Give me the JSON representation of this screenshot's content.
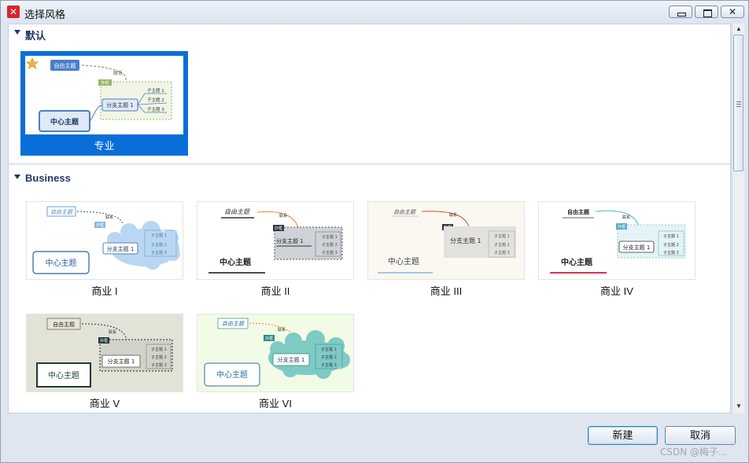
{
  "window": {
    "title": "选择风格",
    "app_icon": "xmind-icon"
  },
  "sections": [
    {
      "header": "默认",
      "items": [
        {
          "label": "专业",
          "selected": true,
          "theme": "professional"
        }
      ]
    },
    {
      "header": "Business",
      "items": [
        {
          "label": "商业 I",
          "theme": "business1"
        },
        {
          "label": "商业 II",
          "theme": "business2"
        },
        {
          "label": "商业 III",
          "theme": "business3"
        },
        {
          "label": "商业 IV",
          "theme": "business4"
        },
        {
          "label": "商业 V",
          "theme": "business5"
        },
        {
          "label": "商业 VI",
          "theme": "business6"
        }
      ]
    }
  ],
  "thumbnail_text": {
    "free_topic": "自由主题",
    "relation": "联系",
    "summary": "外框",
    "central": "中心主题",
    "branch": "分支主题 1",
    "sub1": "子主题 1",
    "sub2": "子主题 2",
    "sub3": "子主题 3"
  },
  "footer": {
    "new_button": "新建",
    "cancel_button": "取消"
  },
  "watermark": "CSDN @梅子...",
  "colors": {
    "selected": "#0a6ed8",
    "section_header": "#1f3b63"
  }
}
